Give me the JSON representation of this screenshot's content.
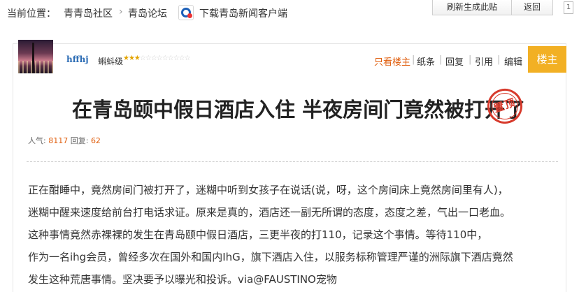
{
  "breadcrumb": {
    "prefix": "当前位置：",
    "items": [
      "青青岛社区",
      "青岛论坛"
    ],
    "separator": "›",
    "download_link": "下载青岛新闻客户端"
  },
  "top_buttons": {
    "refresh": "刷新生成此贴",
    "back": "返回",
    "side_badge": "1"
  },
  "author": {
    "name": "hffhj",
    "rank": "蝌蚪级",
    "stars_on": "★★★",
    "stars_off": "☆☆☆☆☆☆☆☆☆"
  },
  "actions": {
    "only_op": "只看楼主",
    "note": "纸条",
    "reply": "回复",
    "quote": "引用",
    "edit": "编辑",
    "floor": "楼主"
  },
  "post": {
    "title": "在青岛颐中假日酒店入住 半夜房间门竟然被打开了",
    "stamp": "置顶",
    "views_label": "人气:",
    "views": "8117",
    "replies_label": "回复:",
    "replies": "62",
    "body_lines": [
      "正在酣睡中，竟然房间门被打开了，迷糊中听到女孩子在说话(说，呀，这个房间床上竟然房间里有人)，",
      "迷糊中醒来速度给前台打电话求证。原来是真的，酒店还一副无所谓的态度，态度之差，气出一口老血。",
      "这种事情竟然赤裸裸的发生在青岛颐中假日酒店，三更半夜的打110，记录这个事情。等待110中，",
      "作为一名ihg会员，曾经多次在国外和国内IhG，旗下酒店入住，以服务标称管理严谨的洲际旗下酒店竟然",
      "发生这种荒唐事情。坚决要予以曝光和投诉。via@FAUSTINO宠物"
    ]
  },
  "colors": {
    "link_blue": "#2d6db5",
    "accent_orange": "#e05d0c",
    "floor_badge": "#f2b024",
    "stamp_red": "#d73a2c"
  },
  "icons": {
    "app": "qingdao-news-app-icon",
    "avatar": "user-avatar-photo"
  }
}
